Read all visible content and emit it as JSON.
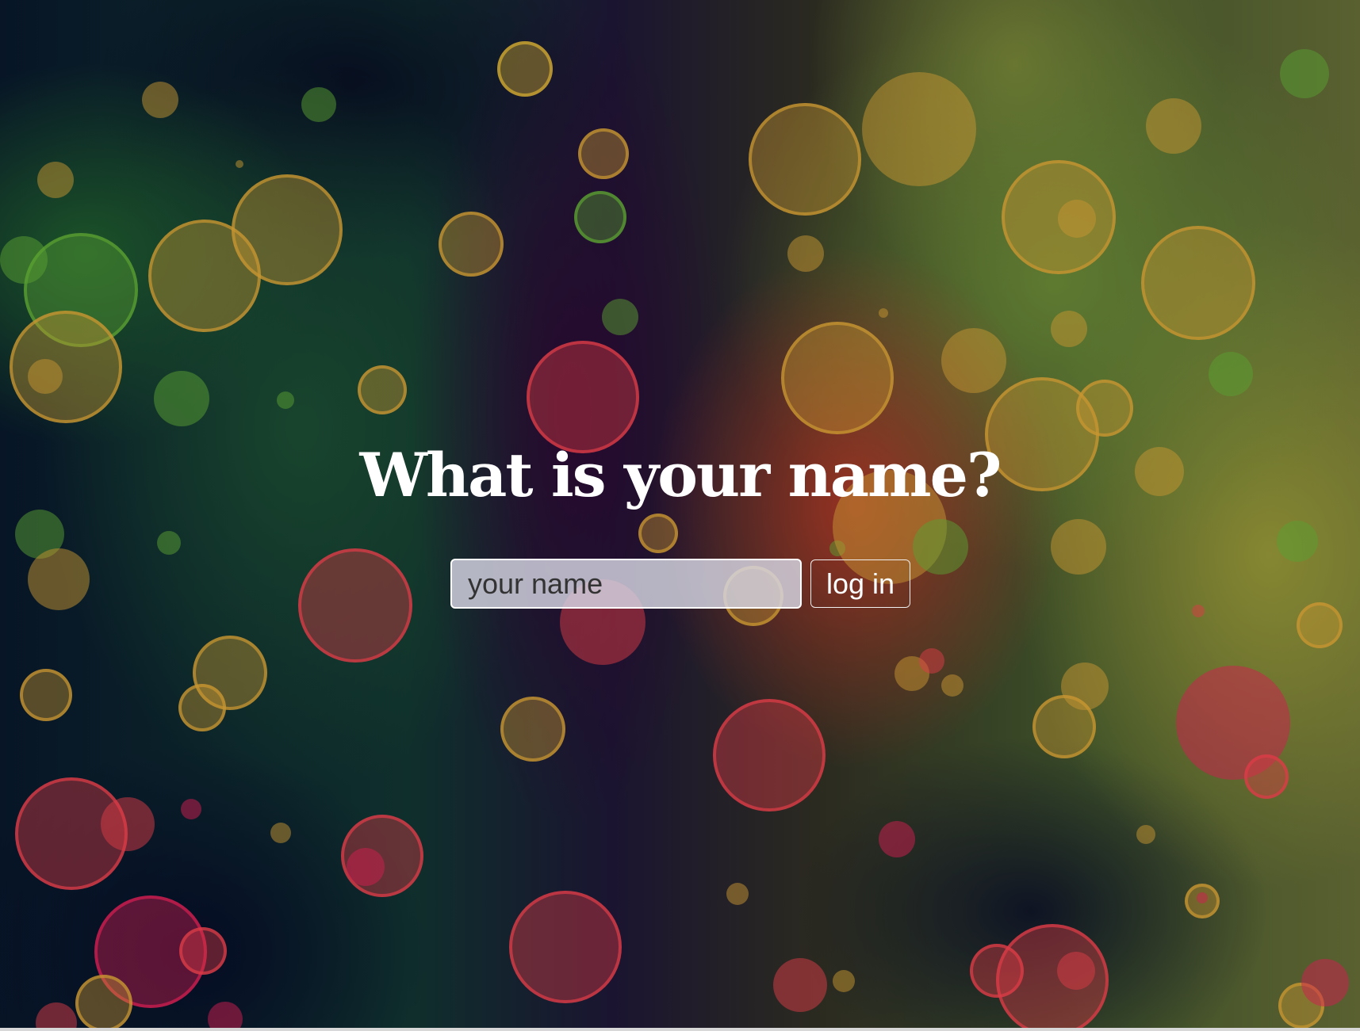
{
  "login": {
    "heading": "What is your name?",
    "name_placeholder": "your name",
    "name_value": "",
    "login_button_label": "log in"
  }
}
